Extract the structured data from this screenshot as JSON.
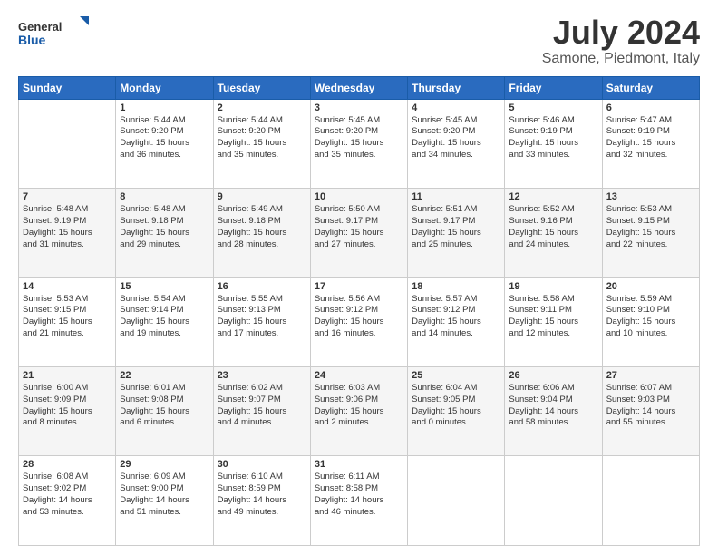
{
  "header": {
    "logo_line1": "General",
    "logo_line2": "Blue",
    "month": "July 2024",
    "location": "Samone, Piedmont, Italy"
  },
  "days_of_week": [
    "Sunday",
    "Monday",
    "Tuesday",
    "Wednesday",
    "Thursday",
    "Friday",
    "Saturday"
  ],
  "weeks": [
    [
      {
        "day": "",
        "info": ""
      },
      {
        "day": "1",
        "info": "Sunrise: 5:44 AM\nSunset: 9:20 PM\nDaylight: 15 hours\nand 36 minutes."
      },
      {
        "day": "2",
        "info": "Sunrise: 5:44 AM\nSunset: 9:20 PM\nDaylight: 15 hours\nand 35 minutes."
      },
      {
        "day": "3",
        "info": "Sunrise: 5:45 AM\nSunset: 9:20 PM\nDaylight: 15 hours\nand 35 minutes."
      },
      {
        "day": "4",
        "info": "Sunrise: 5:45 AM\nSunset: 9:20 PM\nDaylight: 15 hours\nand 34 minutes."
      },
      {
        "day": "5",
        "info": "Sunrise: 5:46 AM\nSunset: 9:19 PM\nDaylight: 15 hours\nand 33 minutes."
      },
      {
        "day": "6",
        "info": "Sunrise: 5:47 AM\nSunset: 9:19 PM\nDaylight: 15 hours\nand 32 minutes."
      }
    ],
    [
      {
        "day": "7",
        "info": "Sunrise: 5:48 AM\nSunset: 9:19 PM\nDaylight: 15 hours\nand 31 minutes."
      },
      {
        "day": "8",
        "info": "Sunrise: 5:48 AM\nSunset: 9:18 PM\nDaylight: 15 hours\nand 29 minutes."
      },
      {
        "day": "9",
        "info": "Sunrise: 5:49 AM\nSunset: 9:18 PM\nDaylight: 15 hours\nand 28 minutes."
      },
      {
        "day": "10",
        "info": "Sunrise: 5:50 AM\nSunset: 9:17 PM\nDaylight: 15 hours\nand 27 minutes."
      },
      {
        "day": "11",
        "info": "Sunrise: 5:51 AM\nSunset: 9:17 PM\nDaylight: 15 hours\nand 25 minutes."
      },
      {
        "day": "12",
        "info": "Sunrise: 5:52 AM\nSunset: 9:16 PM\nDaylight: 15 hours\nand 24 minutes."
      },
      {
        "day": "13",
        "info": "Sunrise: 5:53 AM\nSunset: 9:15 PM\nDaylight: 15 hours\nand 22 minutes."
      }
    ],
    [
      {
        "day": "14",
        "info": "Sunrise: 5:53 AM\nSunset: 9:15 PM\nDaylight: 15 hours\nand 21 minutes."
      },
      {
        "day": "15",
        "info": "Sunrise: 5:54 AM\nSunset: 9:14 PM\nDaylight: 15 hours\nand 19 minutes."
      },
      {
        "day": "16",
        "info": "Sunrise: 5:55 AM\nSunset: 9:13 PM\nDaylight: 15 hours\nand 17 minutes."
      },
      {
        "day": "17",
        "info": "Sunrise: 5:56 AM\nSunset: 9:12 PM\nDaylight: 15 hours\nand 16 minutes."
      },
      {
        "day": "18",
        "info": "Sunrise: 5:57 AM\nSunset: 9:12 PM\nDaylight: 15 hours\nand 14 minutes."
      },
      {
        "day": "19",
        "info": "Sunrise: 5:58 AM\nSunset: 9:11 PM\nDaylight: 15 hours\nand 12 minutes."
      },
      {
        "day": "20",
        "info": "Sunrise: 5:59 AM\nSunset: 9:10 PM\nDaylight: 15 hours\nand 10 minutes."
      }
    ],
    [
      {
        "day": "21",
        "info": "Sunrise: 6:00 AM\nSunset: 9:09 PM\nDaylight: 15 hours\nand 8 minutes."
      },
      {
        "day": "22",
        "info": "Sunrise: 6:01 AM\nSunset: 9:08 PM\nDaylight: 15 hours\nand 6 minutes."
      },
      {
        "day": "23",
        "info": "Sunrise: 6:02 AM\nSunset: 9:07 PM\nDaylight: 15 hours\nand 4 minutes."
      },
      {
        "day": "24",
        "info": "Sunrise: 6:03 AM\nSunset: 9:06 PM\nDaylight: 15 hours\nand 2 minutes."
      },
      {
        "day": "25",
        "info": "Sunrise: 6:04 AM\nSunset: 9:05 PM\nDaylight: 15 hours\nand 0 minutes."
      },
      {
        "day": "26",
        "info": "Sunrise: 6:06 AM\nSunset: 9:04 PM\nDaylight: 14 hours\nand 58 minutes."
      },
      {
        "day": "27",
        "info": "Sunrise: 6:07 AM\nSunset: 9:03 PM\nDaylight: 14 hours\nand 55 minutes."
      }
    ],
    [
      {
        "day": "28",
        "info": "Sunrise: 6:08 AM\nSunset: 9:02 PM\nDaylight: 14 hours\nand 53 minutes."
      },
      {
        "day": "29",
        "info": "Sunrise: 6:09 AM\nSunset: 9:00 PM\nDaylight: 14 hours\nand 51 minutes."
      },
      {
        "day": "30",
        "info": "Sunrise: 6:10 AM\nSunset: 8:59 PM\nDaylight: 14 hours\nand 49 minutes."
      },
      {
        "day": "31",
        "info": "Sunrise: 6:11 AM\nSunset: 8:58 PM\nDaylight: 14 hours\nand 46 minutes."
      },
      {
        "day": "",
        "info": ""
      },
      {
        "day": "",
        "info": ""
      },
      {
        "day": "",
        "info": ""
      }
    ]
  ]
}
